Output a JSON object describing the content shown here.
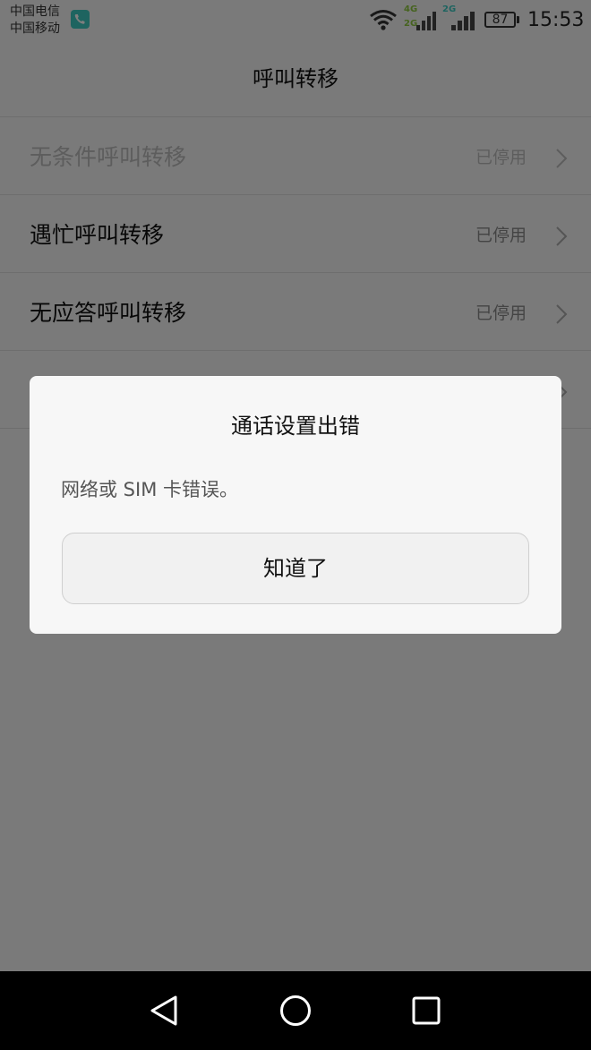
{
  "status_bar": {
    "carrier_1": "中国电信",
    "carrier_2": "中国移动",
    "network_tag_1a": "4G",
    "network_tag_1b": "2G",
    "network_tag_2": "2G",
    "battery_level": "87",
    "time": "15:53",
    "icons": [
      "phone-call-indicator-icon",
      "wifi-icon",
      "signal-icon",
      "signal-icon",
      "battery-icon"
    ]
  },
  "header": {
    "title": "呼叫转移"
  },
  "forwarding_list": {
    "items": [
      {
        "label": "无条件呼叫转移",
        "status": "已停用",
        "enabled": false
      },
      {
        "label": "遇忙呼叫转移",
        "status": "已停用",
        "enabled": true
      },
      {
        "label": "无应答呼叫转移",
        "status": "已停用",
        "enabled": true
      },
      {
        "label": "",
        "status": "",
        "enabled": true
      }
    ]
  },
  "dialog": {
    "title": "通话设置出错",
    "message": "网络或 SIM 卡错误。",
    "button_label": "知道了"
  },
  "nav_bar": {
    "icons": [
      "back-icon",
      "home-icon",
      "recents-icon"
    ]
  },
  "colors": {
    "background": "#f5f5f5",
    "overlay": "rgba(0,0,0,0.5)",
    "dialog_background": "#f7f7f7",
    "tag_green": "#8cc63f",
    "tag_teal": "#3cc8c0",
    "call_indicator": "#3cc8c0"
  }
}
